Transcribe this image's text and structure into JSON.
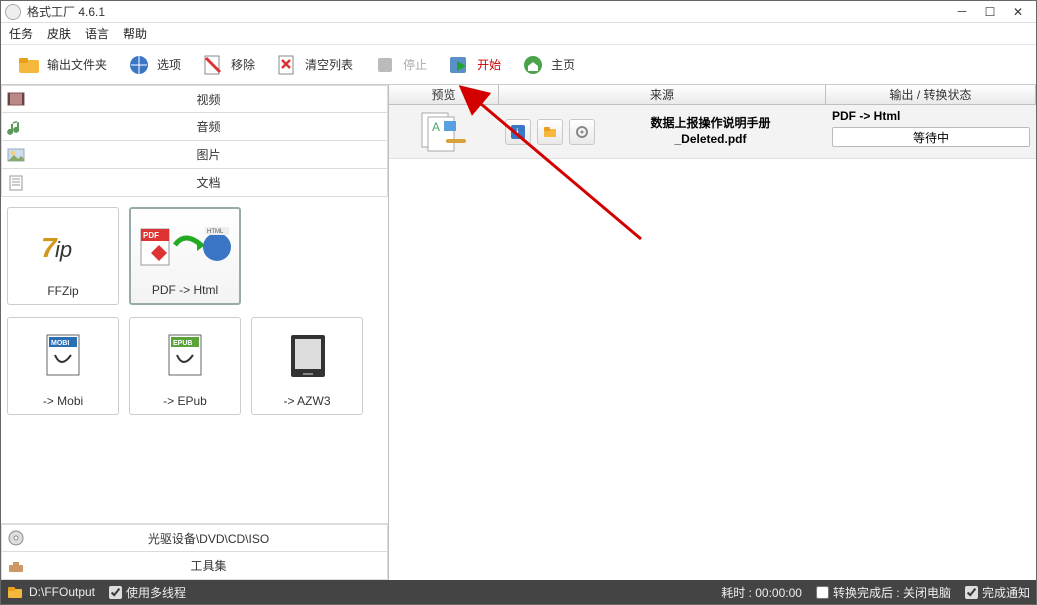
{
  "app": {
    "title": "格式工厂 4.6.1"
  },
  "menu": {
    "tasks": "任务",
    "skin": "皮肤",
    "language": "语言",
    "help": "帮助"
  },
  "toolbar": {
    "output_folder": "输出文件夹",
    "options": "选项",
    "remove": "移除",
    "clear_list": "清空列表",
    "stop": "停止",
    "start": "开始",
    "home": "主页"
  },
  "categories": {
    "video": "视频",
    "audio": "音频",
    "picture": "图片",
    "document": "文档",
    "optical": "光驱设备\\DVD\\CD\\ISO",
    "toolset": "工具集"
  },
  "tiles": {
    "ffzip": "FFZip",
    "pdf_html": "PDF -> Html",
    "mobi": "-> Mobi",
    "epub": "-> EPub",
    "azw3": "-> AZW3"
  },
  "list": {
    "head_preview": "预览",
    "head_source": "来源",
    "head_status": "输出 / 转换状态",
    "row0": {
      "source_line1": "数据上报操作说明手册",
      "source_line2": "_Deleted.pdf",
      "output": "PDF -> Html",
      "status": "等待中"
    }
  },
  "statusbar": {
    "folder": "D:\\FFOutput",
    "multithread": "使用多线程",
    "elapsed_label": "耗时 : ",
    "elapsed_value": "00:00:00",
    "after_label": "转换完成后 : 关闭电脑",
    "notify_label": "完成通知"
  }
}
